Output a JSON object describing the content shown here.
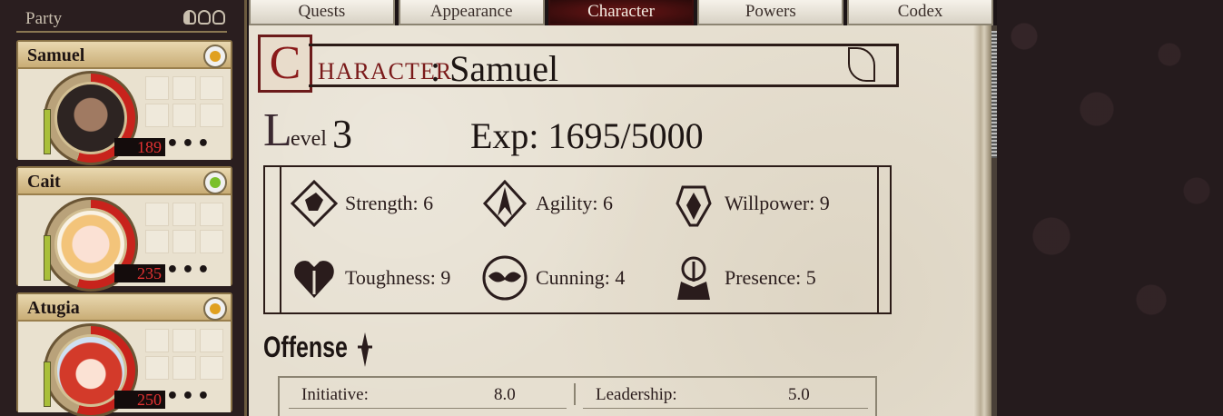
{
  "party": {
    "title": "Party",
    "members": [
      {
        "name": "Samuel",
        "hp": "189",
        "mood_color": "#e0a020"
      },
      {
        "name": "Cait",
        "hp": "235",
        "mood_color": "#7ac02a"
      },
      {
        "name": "Atugia",
        "hp": "250",
        "mood_color": "#e0a020"
      }
    ],
    "more_label": "•••"
  },
  "tabs": [
    {
      "label": "Quests",
      "active": false
    },
    {
      "label": "Appearance",
      "active": false
    },
    {
      "label": "Character",
      "active": true
    },
    {
      "label": "Powers",
      "active": false
    },
    {
      "label": "Codex",
      "active": false
    }
  ],
  "character": {
    "header_cap": "C",
    "header_small": "HARACTER",
    "name": ": Samuel",
    "level_cap": "L",
    "level_word": "evel",
    "level_value": "3",
    "exp": "Exp: 1695/5000"
  },
  "attributes": [
    {
      "label": "Strength: 6",
      "icon": "strength-icon"
    },
    {
      "label": "Agility: 6",
      "icon": "agility-icon"
    },
    {
      "label": "Willpower: 9",
      "icon": "willpower-icon"
    },
    {
      "label": "Toughness: 9",
      "icon": "toughness-icon"
    },
    {
      "label": "Cunning: 4",
      "icon": "cunning-icon"
    },
    {
      "label": "Presence: 5",
      "icon": "presence-icon"
    }
  ],
  "offense": {
    "title": "Offense",
    "rows": [
      {
        "label": "Initiative:",
        "value": "8.0"
      },
      {
        "label": "Leadership:",
        "value": "5.0"
      }
    ]
  }
}
